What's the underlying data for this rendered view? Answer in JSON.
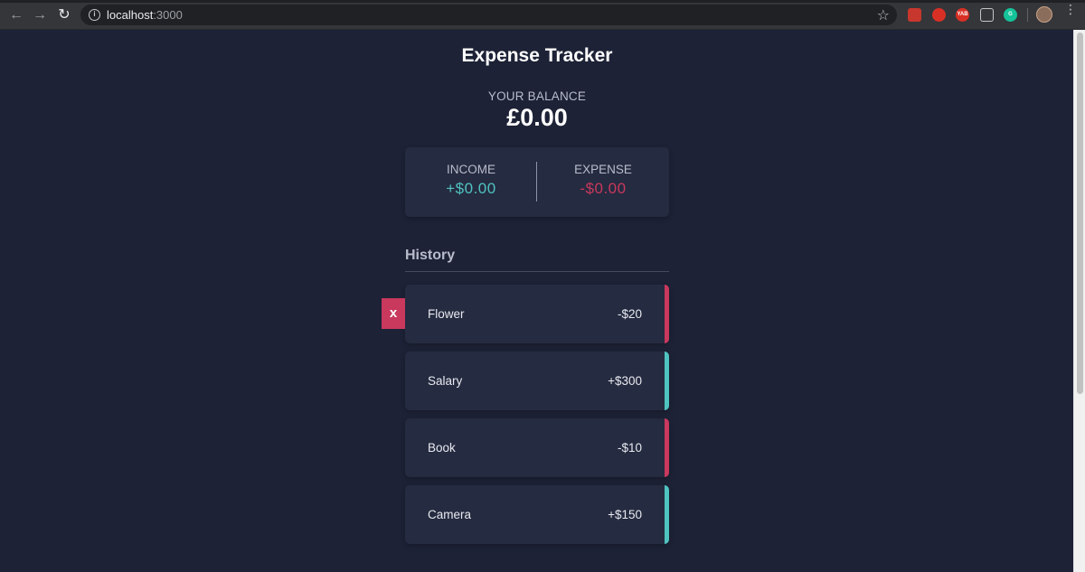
{
  "browser": {
    "url_host": "localhost",
    "url_port": ":3000",
    "extensions": [
      "",
      "",
      "YAB",
      "",
      "G"
    ]
  },
  "app": {
    "title": "Expense Tracker",
    "balance_label": "YOUR BALANCE",
    "balance_value": "£0.00",
    "income_label": "INCOME",
    "income_value": "+$0.00",
    "expense_label": "EXPENSE",
    "expense_value": "-$0.00",
    "history_title": "History",
    "delete_label": "x",
    "transactions": [
      {
        "name": "Flower",
        "amount": "-$20",
        "type": "minus"
      },
      {
        "name": "Salary",
        "amount": "+$300",
        "type": "plus"
      },
      {
        "name": "Book",
        "amount": "-$10",
        "type": "minus"
      },
      {
        "name": "Camera",
        "amount": "+$150",
        "type": "plus"
      }
    ]
  },
  "colors": {
    "background": "#1d2236",
    "card": "#252b40",
    "plus": "#4fc3c0",
    "minus": "#c9385d"
  }
}
